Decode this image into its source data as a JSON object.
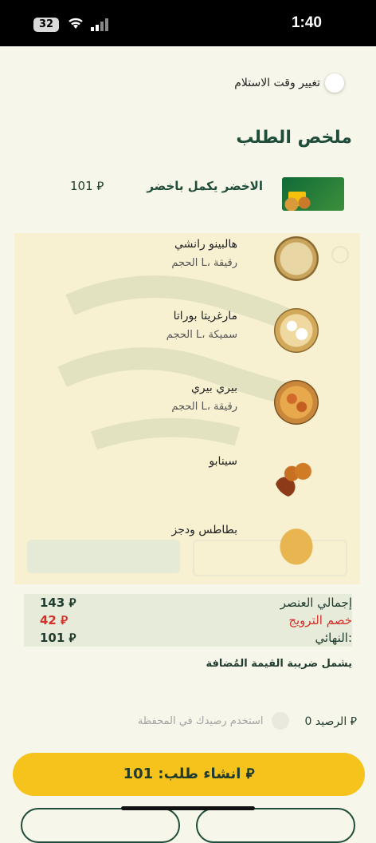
{
  "status_bar": {
    "battery": "32",
    "time": "1:40"
  },
  "pickup": {
    "toggle_label": "تغيير وقت الاستلام"
  },
  "summary": {
    "title": "ملخص الطلب"
  },
  "offer": {
    "name": "الاخضر يكمل باخضر",
    "price": "101 ⃁"
  },
  "items": [
    {
      "name": "هالبينو رانشي",
      "meta": "الحجم L، رقيقة",
      "icon": "pizza-icon"
    },
    {
      "name": "مارغريتا بوراتا",
      "meta": "الحجم L، سميكة",
      "icon": "pizza-icon"
    },
    {
      "name": "بيري بيري",
      "meta": "الحجم L، رقيقة",
      "icon": "pizza-icon"
    },
    {
      "name": "سينابو",
      "meta": "",
      "icon": "bites-icon"
    },
    {
      "name": "بطاطس ودجز",
      "meta": "",
      "icon": "fries-icon"
    }
  ],
  "totals": {
    "item_total_label": "إجمالي العنصر",
    "item_total_value": "143 ⃁",
    "promo_label": "خصم الترويج",
    "promo_value": "42 ⃁",
    "final_label": "النهائي:",
    "final_value": "101 ⃁"
  },
  "vat_note": "يشمل ضريبة القيمة المُضافة",
  "wallet": {
    "balance": "الرصيد 0 ⃁",
    "use_label": "استخدم رصيدك في المحفظة"
  },
  "cta": {
    "label": "انشاء طلب: 101 ⃁"
  },
  "colors": {
    "brand_green": "#1f4d3a",
    "accent_yellow": "#f6c21c",
    "promo_red": "#d3312b",
    "background": "#f6f6ea"
  }
}
